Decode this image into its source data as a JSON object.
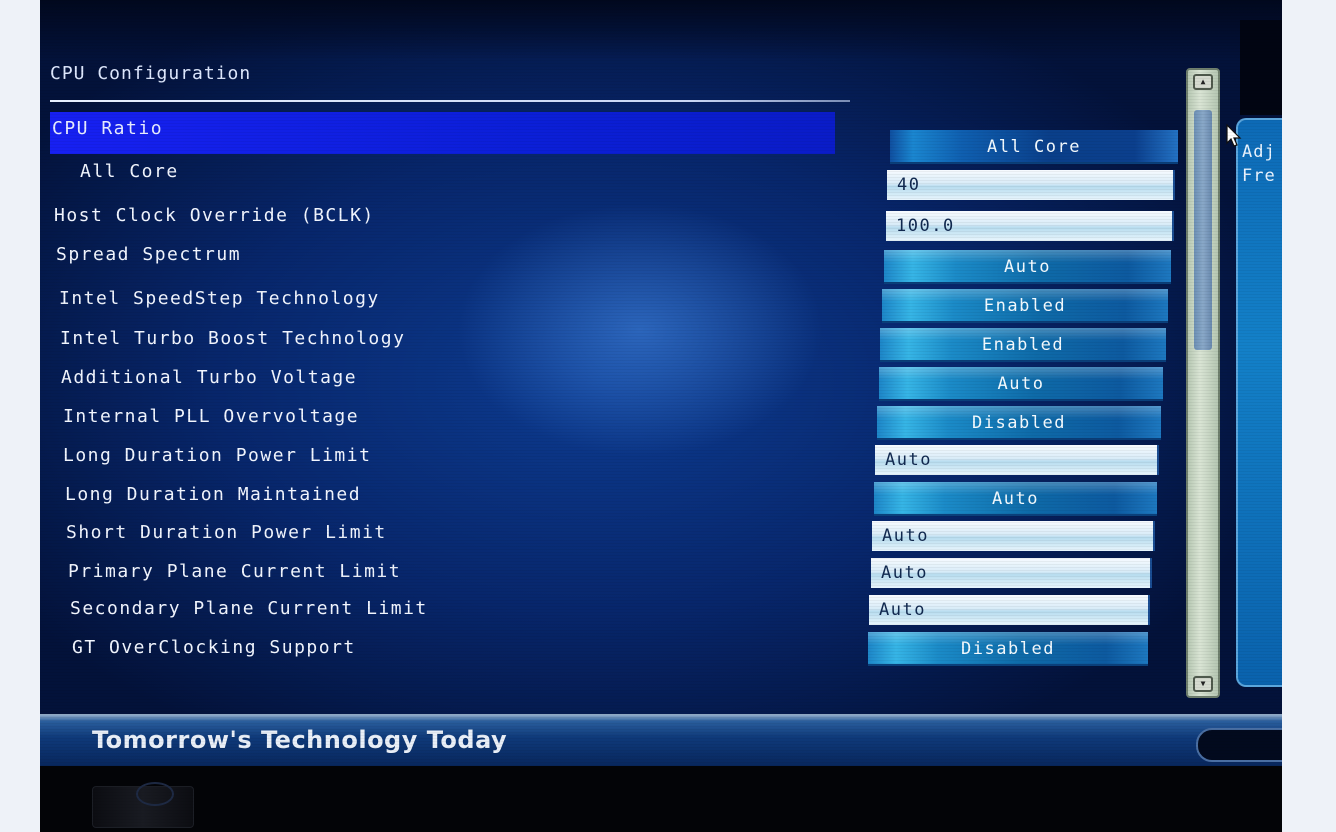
{
  "page": {
    "title": "CPU Configuration"
  },
  "settings": [
    {
      "label": "CPU Ratio",
      "value": "All Core"
    },
    {
      "label": "All Core",
      "value": "40"
    },
    {
      "label": "Host Clock Override (BCLK)",
      "value": "100.0"
    },
    {
      "label": "Spread Spectrum",
      "value": "Auto"
    },
    {
      "label": "Intel SpeedStep Technology",
      "value": "Enabled"
    },
    {
      "label": "Intel Turbo Boost Technology",
      "value": "Enabled"
    },
    {
      "label": "Additional Turbo Voltage",
      "value": "Auto"
    },
    {
      "label": "Internal PLL Overvoltage",
      "value": "Disabled"
    },
    {
      "label": "Long Duration Power Limit",
      "value": "Auto"
    },
    {
      "label": "Long Duration Maintained",
      "value": "Auto"
    },
    {
      "label": "Short Duration Power Limit",
      "value": "Auto"
    },
    {
      "label": "Primary Plane Current Limit",
      "value": "Auto"
    },
    {
      "label": "Secondary Plane Current Limit",
      "value": "Auto"
    },
    {
      "label": "GT OverClocking Support",
      "value": "Disabled"
    }
  ],
  "help": {
    "line1": "Adj",
    "line2": "Fre"
  },
  "footer": {
    "slogan": "Tomorrow's Technology Today"
  },
  "icons": {
    "scroll_up": "arrow-up-icon",
    "scroll_down": "arrow-down-icon",
    "pointer": "mouse-pointer-icon"
  },
  "colors": {
    "selection": "#1720f2",
    "background": "#07266b",
    "option_button": "#1b8bc8",
    "input_field": "#d9ecf8"
  }
}
